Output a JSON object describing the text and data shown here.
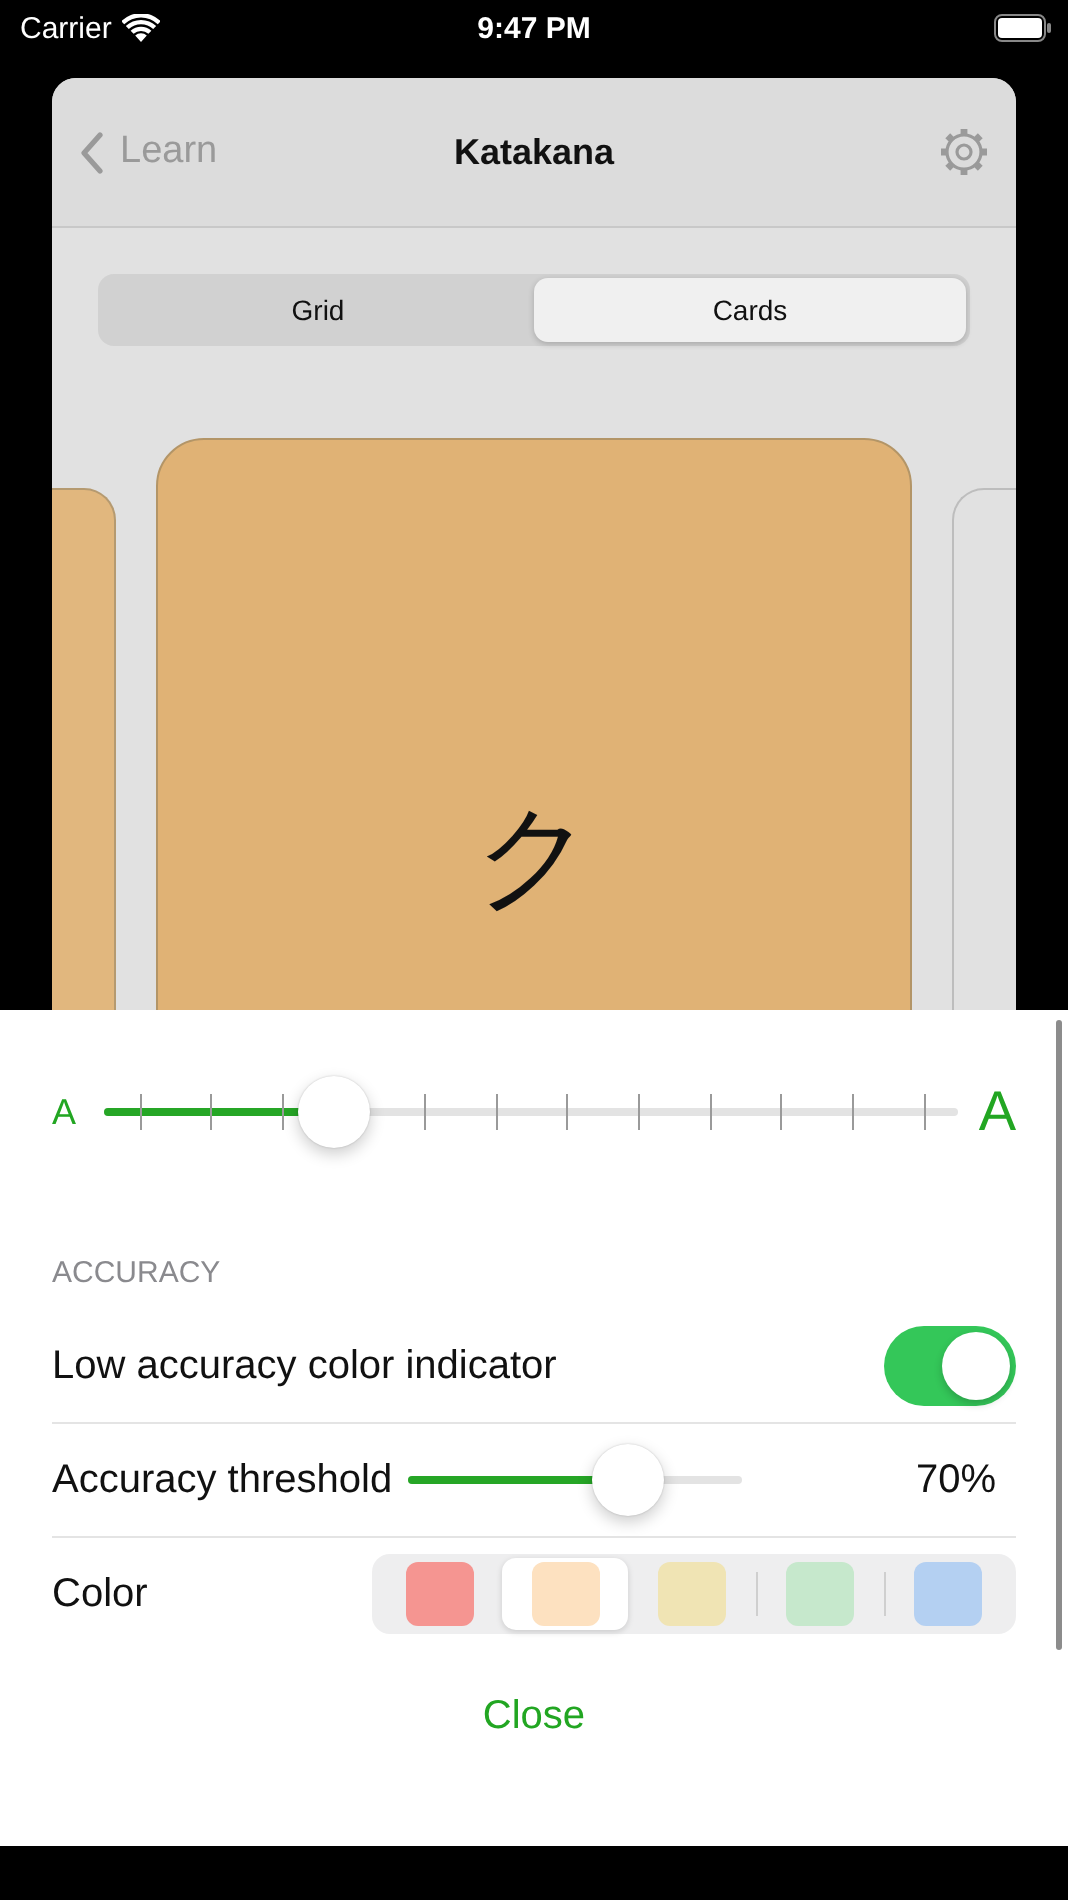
{
  "status_bar": {
    "carrier": "Carrier",
    "time": "9:47 PM"
  },
  "nav": {
    "back": "Learn",
    "title": "Katakana"
  },
  "tabs": [
    {
      "label": "Grid",
      "selected": false
    },
    {
      "label": "Cards",
      "selected": true
    }
  ],
  "card": {
    "kana": "ク"
  },
  "font_size": {
    "small_label": "A",
    "large_label": "A",
    "level": 0.27
  },
  "section": "ACCURACY",
  "settings": [
    {
      "kind": "toggle",
      "label": "Low accuracy color indicator",
      "on": true
    },
    {
      "kind": "slider",
      "label": "Accuracy threshold",
      "level": 0.66,
      "reading": "70%"
    },
    {
      "kind": "swatches",
      "label": "Color",
      "swatches": [
        {
          "color": "#f59591",
          "selected": false
        },
        {
          "color": "#fde1c0",
          "selected": true
        },
        {
          "color": "#f0e4b4",
          "selected": false
        },
        {
          "color": "#c6e8cc",
          "selected": false
        },
        {
          "color": "#b4d0f2",
          "selected": false
        }
      ]
    }
  ],
  "close": "Close"
}
